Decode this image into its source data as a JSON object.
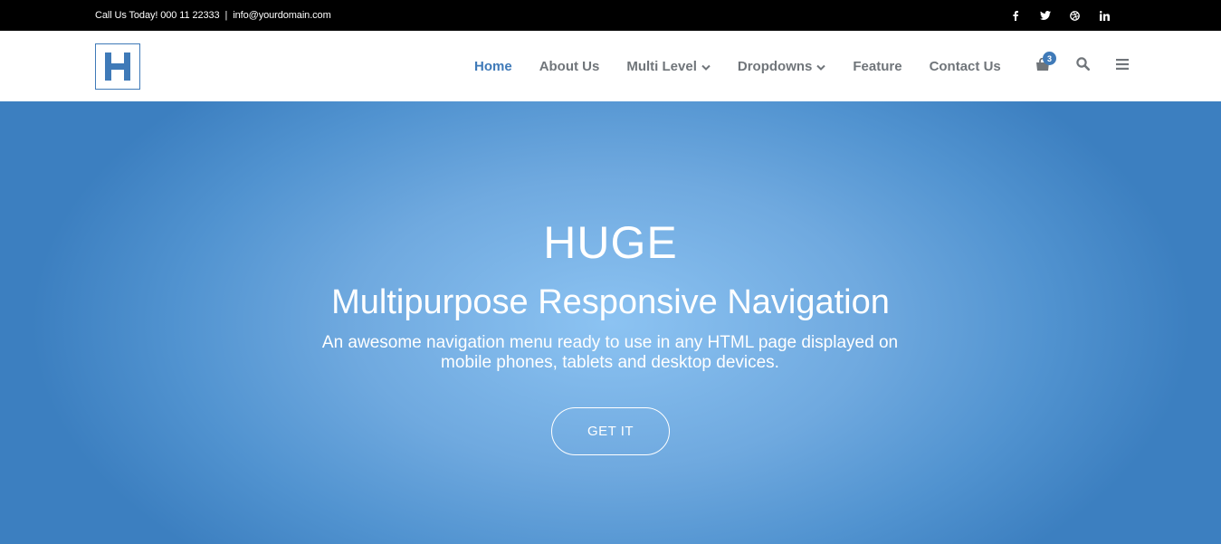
{
  "topbar": {
    "phone_text": "Call Us Today! 000 11 22333",
    "separator": "|",
    "email_text": "info@yourdomain.com",
    "social": [
      "facebook-icon",
      "twitter-icon",
      "dribbble-icon",
      "linkedin-icon"
    ]
  },
  "header": {
    "logo_letter": "H",
    "nav": {
      "home": "Home",
      "about": "About Us",
      "multi_level": "Multi Level",
      "dropdowns": "Dropdowns",
      "feature": "Feature",
      "contact": "Contact Us"
    },
    "cart_count": "3",
    "active_item": "Home"
  },
  "hero": {
    "title": "HUGE",
    "subtitle": "Multipurpose Responsive Navigation",
    "description": "An awesome navigation menu ready to use in any HTML page displayed on mobile phones, tablets and desktop devices.",
    "button_label": "GET IT"
  },
  "colors": {
    "accent": "#3f7ab8",
    "nav_text": "#70757a",
    "topbar_bg": "#000000",
    "hero_light": "#8cc3f2",
    "hero_dark": "#3c7fc0"
  }
}
